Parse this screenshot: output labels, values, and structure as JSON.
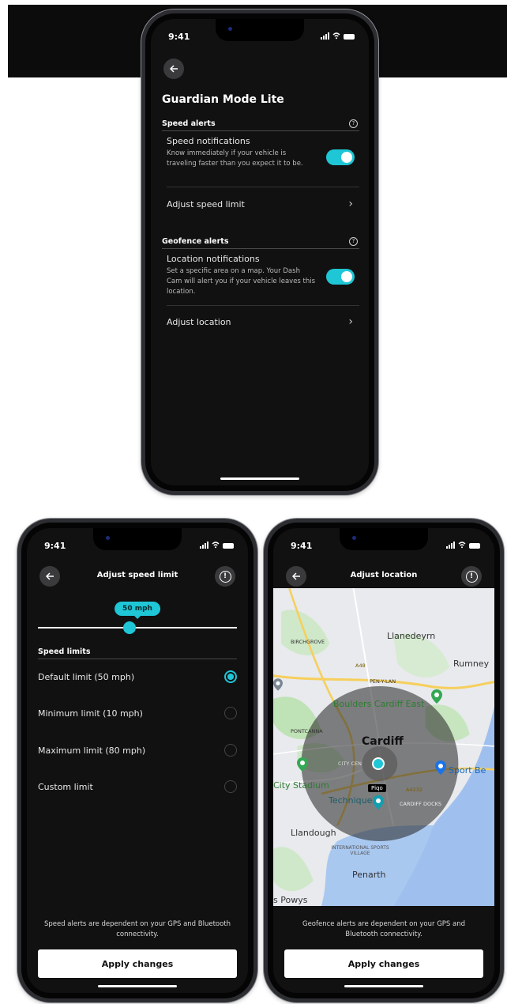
{
  "status": {
    "time": "9:41"
  },
  "guardian": {
    "title": "Guardian Mode Lite",
    "speed_section": "Speed alerts",
    "speed_notif_title": "Speed notifications",
    "speed_notif_desc": "Know immediately if your vehicle is traveling faster than you expect it to be.",
    "speed_notif_on": true,
    "adjust_speed": "Adjust speed limit",
    "geo_section": "Geofence alerts",
    "loc_notif_title": "Location notifications",
    "loc_notif_desc": "Set a specific area on a map. Your Dash Cam will alert you if your vehicle leaves this location.",
    "loc_notif_on": true,
    "adjust_location": "Adjust location"
  },
  "speed_limit": {
    "title": "Adjust speed limit",
    "pill": "50 mph",
    "slider_fraction": 0.46,
    "section": "Speed limits",
    "options": [
      {
        "label": "Default limit (50 mph)",
        "selected": true
      },
      {
        "label": "Minimum limit (10 mph)",
        "selected": false
      },
      {
        "label": "Maximum limit (80 mph)",
        "selected": false
      },
      {
        "label": "Custom limit",
        "selected": false
      }
    ],
    "note": "Speed alerts are dependent on your GPS and Bluetooth connectivity.",
    "apply": "Apply changes"
  },
  "location": {
    "title": "Adjust location",
    "map_labels": {
      "llanedeyrn": "Llanedeyrn",
      "birchgrove": "BIRCHGROVE",
      "rumney": "Rumney",
      "penylan": "PEN-Y-LAN",
      "boulders": "Boulders Cardiff East",
      "pontcanna": "PONTCANNA",
      "cardiff": "Cardiff",
      "citycentre": "CITY CEN",
      "stadium": "City Stadium",
      "sportbe": "Sport Be",
      "techniquest": "Techniquest",
      "cardiffdocks": "CARDIFF DOCKS",
      "piqo": "Piqo",
      "llandough": "Llandough",
      "isv": "INTERNATIONAL SPORTS VILLAGE",
      "penarth": "Penarth",
      "powys": "s Powys",
      "a48": "A48",
      "a4232": "A4232"
    },
    "note": "Geofence alerts are dependent on your GPS and Bluetooth connectivity.",
    "apply": "Apply changes"
  },
  "colors": {
    "accent": "#1ec6d6",
    "screen_bg": "#111111"
  }
}
